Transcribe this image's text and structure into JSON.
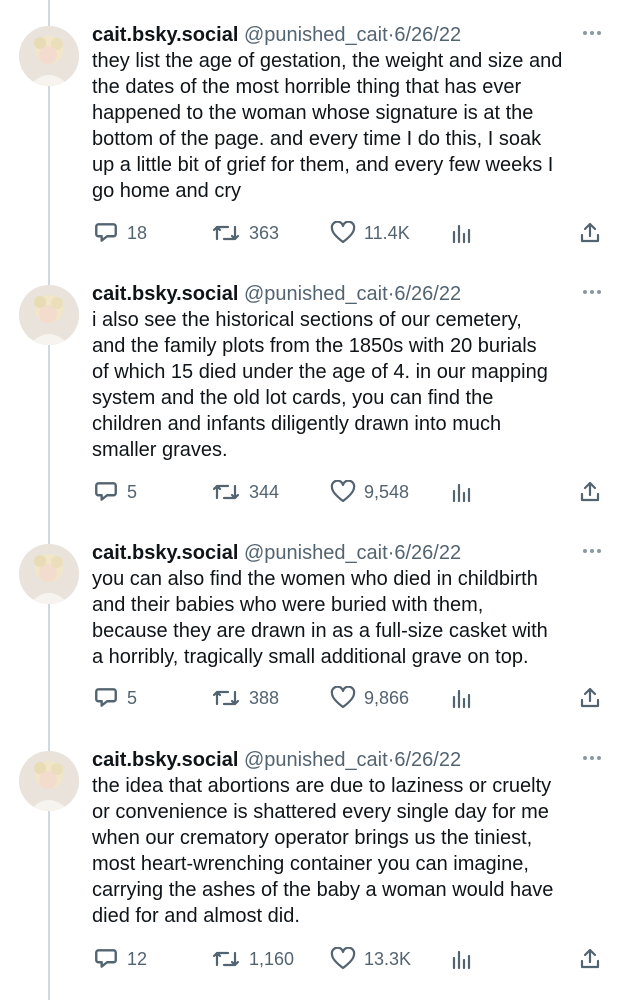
{
  "tweets": [
    {
      "display_name": "cait.bsky.social",
      "handle": "@punished_cait",
      "separator": "·",
      "date": "6/26/22",
      "lines": [
        "they list the age of gestation, the weight and size and",
        "the dates of the most horrible thing that has ever",
        "happened to the woman whose signature is at the",
        "bottom of the page. and every time I do this, I soak",
        "up a little bit of grief for them, and every few weeks I",
        "go home and cry"
      ],
      "replies": "18",
      "retweets": "363",
      "likes": "11.4K"
    },
    {
      "display_name": "cait.bsky.social",
      "handle": "@punished_cait",
      "separator": "·",
      "date": "6/26/22",
      "lines": [
        "i also see the historical sections of our cemetery,",
        "and the family plots from the 1850s with 20 burials",
        "of which 15 died under the age of 4. in our mapping",
        "system and the old lot cards, you can find the",
        "children and infants diligently drawn into much",
        "smaller graves."
      ],
      "replies": "5",
      "retweets": "344",
      "likes": "9,548"
    },
    {
      "display_name": "cait.bsky.social",
      "handle": "@punished_cait",
      "separator": "·",
      "date": "6/26/22",
      "lines": [
        "you can also find the women who died in childbirth",
        "and their babies who were buried with them,",
        "because they are drawn in as a full-size casket with",
        "a horribly, tragically small additional grave on top."
      ],
      "replies": "5",
      "retweets": "388",
      "likes": "9,866"
    },
    {
      "display_name": "cait.bsky.social",
      "handle": "@punished_cait",
      "separator": "·",
      "date": "6/26/22",
      "lines": [
        "the idea that abortions are due to laziness or cruelty",
        "or convenience is shattered every single day for me",
        "when our crematory operator brings us the tiniest,",
        "most heart-wrenching container you can imagine,",
        "carrying the ashes of the baby a woman would have",
        "died for and almost did."
      ],
      "replies": "12",
      "retweets": "1,160",
      "likes": "13.3K"
    }
  ],
  "icons": {
    "avatar": "avatar-photo",
    "more": "more-horizontal-icon",
    "reply": "reply-bubble-icon",
    "retweet": "retweet-arrows-icon",
    "like": "heart-icon",
    "views": "analytics-bars-icon",
    "share": "share-upload-icon"
  },
  "colors": {
    "text": "#0f1419",
    "secondary": "#536471",
    "thread_line": "#cfd9de"
  }
}
